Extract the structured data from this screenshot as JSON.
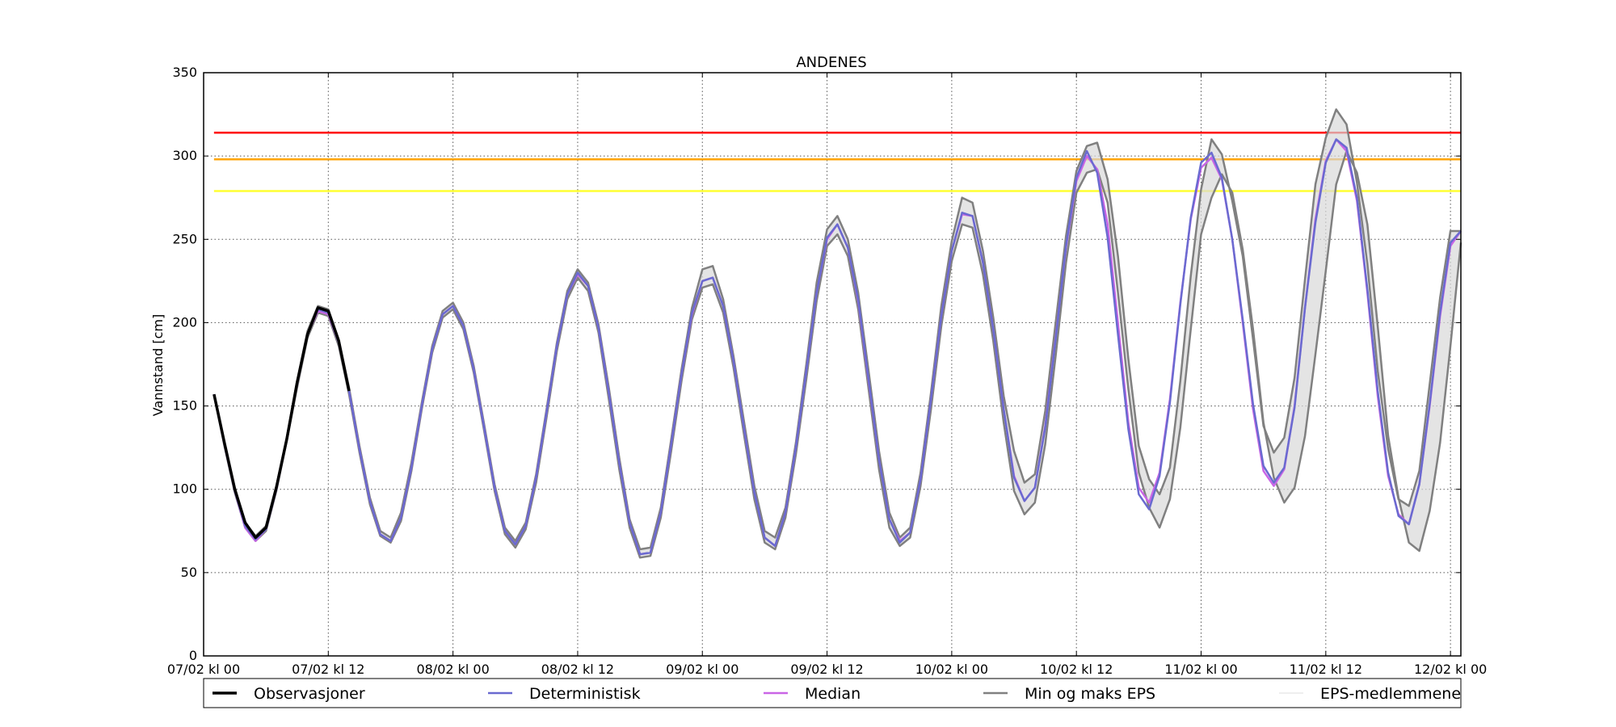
{
  "chart_data": {
    "type": "line",
    "title": "ANDENES",
    "xlabel": "",
    "ylabel": "Vannstand [cm]",
    "xlim_hours": [
      0,
      121
    ],
    "ylim": [
      0,
      350
    ],
    "x_ticks": [
      {
        "hour": 0,
        "label": "07/02 kl 00"
      },
      {
        "hour": 12,
        "label": "07/02 kl 12"
      },
      {
        "hour": 24,
        "label": "08/02 kl 00"
      },
      {
        "hour": 36,
        "label": "08/02 kl 12"
      },
      {
        "hour": 48,
        "label": "09/02 kl 00"
      },
      {
        "hour": 60,
        "label": "09/02 kl 12"
      },
      {
        "hour": 72,
        "label": "10/02 kl 00"
      },
      {
        "hour": 84,
        "label": "10/02 kl 12"
      },
      {
        "hour": 96,
        "label": "11/02 kl 00"
      },
      {
        "hour": 108,
        "label": "11/02 kl 12"
      },
      {
        "hour": 120,
        "label": "12/02 kl 00"
      }
    ],
    "y_ticks": [
      0,
      50,
      100,
      150,
      200,
      250,
      300,
      350
    ],
    "grid": true,
    "thresholds": [
      {
        "value": 314,
        "color": "#ff0000"
      },
      {
        "value": 298,
        "color": "#ffa500"
      },
      {
        "value": 279,
        "color": "#ffff33"
      }
    ],
    "hours": [
      1,
      2,
      3,
      4,
      5,
      6,
      7,
      8,
      9,
      10,
      11,
      12,
      13,
      14,
      15,
      16,
      17,
      18,
      19,
      20,
      21,
      22,
      23,
      24,
      25,
      26,
      27,
      28,
      29,
      30,
      31,
      32,
      33,
      34,
      35,
      36,
      37,
      38,
      39,
      40,
      41,
      42,
      43,
      44,
      45,
      46,
      47,
      48,
      49,
      50,
      51,
      52,
      53,
      54,
      55,
      56,
      57,
      58,
      59,
      60,
      61,
      62,
      63,
      64,
      65,
      66,
      67,
      68,
      69,
      70,
      71,
      72,
      73,
      74,
      75,
      76,
      77,
      78,
      79,
      80,
      81,
      82,
      83,
      84,
      85,
      86,
      87,
      88,
      89,
      90,
      91,
      92,
      93,
      94,
      95,
      96,
      97,
      98,
      99,
      100,
      101,
      102,
      103,
      104,
      105,
      106,
      107,
      108,
      109,
      110,
      111,
      112,
      113,
      114,
      115,
      116,
      117,
      118,
      119,
      120,
      121
    ],
    "series": [
      {
        "name": "Observasjoner",
        "color": "#000000",
        "hours": [
          1,
          2,
          3,
          4,
          5,
          6,
          7,
          8,
          9,
          10,
          11,
          12,
          13,
          14
        ],
        "values": [
          157,
          128,
          100,
          80,
          71,
          77,
          101,
          130,
          164,
          193,
          209,
          207,
          189,
          159
        ]
      },
      {
        "name": "Deterministisk",
        "color": "#6a6ad0",
        "values": [
          157,
          127,
          99,
          78,
          70,
          76,
          100,
          130,
          163,
          193,
          208,
          206,
          188,
          159,
          124,
          93,
          73,
          69,
          83,
          113,
          150,
          184,
          205,
          210,
          198,
          172,
          137,
          101,
          75,
          67,
          78,
          107,
          146,
          186,
          217,
          230,
          222,
          197,
          158,
          116,
          80,
          61,
          62,
          86,
          127,
          169,
          206,
          225,
          227,
          210,
          177,
          137,
          98,
          71,
          66,
          86,
          125,
          171,
          218,
          251,
          259,
          245,
          214,
          166,
          118,
          82,
          68,
          74,
          106,
          154,
          204,
          243,
          266,
          264,
          236,
          196,
          148,
          107,
          93,
          101,
          137,
          190,
          246,
          287,
          303,
          290,
          251,
          193,
          136,
          97,
          88,
          108,
          152,
          211,
          263,
          296,
          302,
          287,
          250,
          202,
          151,
          114,
          104,
          113,
          149,
          209,
          260,
          296,
          310,
          305,
          275,
          220,
          159,
          110,
          84,
          79,
          103,
          151,
          206,
          248,
          255
        ],
        "ensemble_min": [
          157,
          126,
          98,
          77,
          69,
          75,
          99,
          129,
          161,
          191,
          206,
          204,
          186,
          157,
          122,
          91,
          72,
          68,
          81,
          111,
          148,
          182,
          203,
          208,
          196,
          170,
          135,
          99,
          73,
          65,
          76,
          104,
          143,
          183,
          214,
          227,
          219,
          194,
          154,
          112,
          77,
          59,
          60,
          83,
          123,
          165,
          202,
          221,
          223,
          206,
          173,
          133,
          94,
          68,
          64,
          83,
          121,
          166,
          213,
          246,
          253,
          240,
          208,
          160,
          112,
          77,
          66,
          71,
          102,
          148,
          198,
          237,
          259,
          257,
          229,
          189,
          140,
          99,
          85,
          92,
          127,
          180,
          236,
          278,
          290,
          292,
          272,
          218,
          160,
          110,
          89,
          77,
          94,
          137,
          196,
          253,
          275,
          289,
          278,
          244,
          196,
          140,
          107,
          92,
          101,
          132,
          181,
          231,
          283,
          303,
          290,
          259,
          198,
          132,
          95,
          68,
          63,
          87,
          128,
          186,
          248
        ],
        "ensemble_max": [
          157,
          128,
          101,
          80,
          72,
          78,
          102,
          131,
          165,
          195,
          210,
          208,
          190,
          161,
          126,
          95,
          75,
          71,
          86,
          116,
          152,
          186,
          207,
          212,
          200,
          174,
          139,
          103,
          77,
          69,
          80,
          109,
          148,
          188,
          219,
          232,
          224,
          199,
          161,
          119,
          82,
          64,
          65,
          89,
          130,
          172,
          209,
          232,
          234,
          214,
          180,
          141,
          102,
          75,
          71,
          89,
          128,
          175,
          224,
          256,
          264,
          250,
          218,
          171,
          123,
          86,
          71,
          77,
          110,
          158,
          210,
          249,
          275,
          272,
          243,
          203,
          156,
          123,
          104,
          109,
          147,
          200,
          252,
          291,
          306,
          308,
          286,
          240,
          178,
          126,
          106,
          97,
          113,
          165,
          228,
          280,
          310,
          301,
          273,
          240,
          190,
          138,
          122,
          131,
          167,
          226,
          283,
          311,
          328,
          319,
          284,
          235,
          171,
          124,
          94,
          90,
          111,
          163,
          215,
          255,
          255
        ]
      },
      {
        "name": "Median",
        "color": "#c965e6",
        "values": [
          157,
          127,
          99,
          77,
          69,
          76,
          100,
          130,
          163,
          193,
          207,
          205,
          188,
          159,
          124,
          93,
          73,
          69,
          83,
          113,
          150,
          184,
          205,
          210,
          198,
          172,
          137,
          101,
          75,
          67,
          78,
          107,
          146,
          186,
          217,
          229,
          222,
          197,
          158,
          116,
          80,
          61,
          62,
          86,
          127,
          169,
          205,
          225,
          227,
          210,
          177,
          137,
          98,
          71,
          66,
          86,
          125,
          171,
          218,
          250,
          259,
          245,
          213,
          165,
          118,
          82,
          69,
          74,
          106,
          154,
          204,
          243,
          265,
          264,
          236,
          196,
          148,
          108,
          93,
          101,
          138,
          191,
          245,
          285,
          300,
          292,
          259,
          200,
          140,
          101,
          92,
          110,
          154,
          212,
          262,
          293,
          299,
          286,
          250,
          200,
          148,
          111,
          102,
          112,
          150,
          209,
          262,
          297,
          310,
          303,
          273,
          218,
          156,
          108,
          85,
          79,
          103,
          150,
          204,
          246,
          255
        ]
      }
    ],
    "legend": [
      {
        "label": "Observasjoner",
        "color": "#000000"
      },
      {
        "label": "Deterministisk",
        "color": "#6a6ad0"
      },
      {
        "label": "Median",
        "color": "#c965e6"
      },
      {
        "label": "Min og maks EPS",
        "color": "#808080"
      },
      {
        "label": "EPS-medlemmene",
        "color": "#dddddd"
      }
    ]
  }
}
